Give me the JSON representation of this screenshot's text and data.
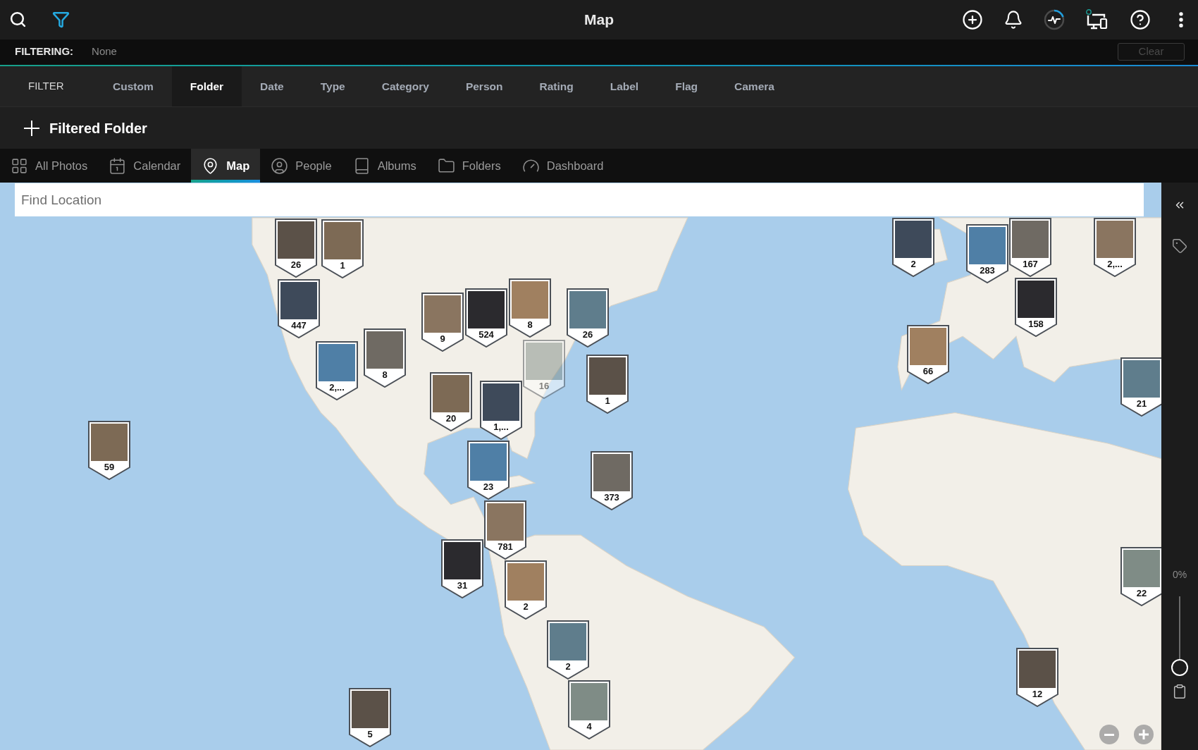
{
  "top_bar": {
    "title": "Map"
  },
  "filter_status": {
    "label": "FILTERING:",
    "value": "None",
    "clear_button": {
      "label": "Clear",
      "disabled": true
    }
  },
  "filter_bar": {
    "heading": "FILTER",
    "tabs": [
      {
        "label": "Custom",
        "selected": false
      },
      {
        "label": "Folder",
        "selected": true
      },
      {
        "label": "Date",
        "selected": false
      },
      {
        "label": "Type",
        "selected": false
      },
      {
        "label": "Category",
        "selected": false
      },
      {
        "label": "Person",
        "selected": false
      },
      {
        "label": "Rating",
        "selected": false
      },
      {
        "label": "Label",
        "selected": false
      },
      {
        "label": "Flag",
        "selected": false
      },
      {
        "label": "Camera",
        "selected": false
      }
    ]
  },
  "filtered_folder": {
    "label": "Filtered Folder"
  },
  "view_tabs": [
    {
      "label": "All Photos",
      "selected": false
    },
    {
      "label": "Calendar",
      "selected": false
    },
    {
      "label": "Map",
      "selected": true
    },
    {
      "label": "People",
      "selected": false
    },
    {
      "label": "Albums",
      "selected": false
    },
    {
      "label": "Folders",
      "selected": false
    },
    {
      "label": "Dashboard",
      "selected": false
    }
  ],
  "map": {
    "search": {
      "placeholder": "Find Location"
    },
    "markers": [
      {
        "count": "26",
        "dimmed": false
      },
      {
        "count": "1",
        "dimmed": false
      },
      {
        "count": "447",
        "dimmed": false
      },
      {
        "count": "2,...",
        "dimmed": false
      },
      {
        "count": "8",
        "dimmed": false
      },
      {
        "count": "9",
        "dimmed": false
      },
      {
        "count": "524",
        "dimmed": false
      },
      {
        "count": "8",
        "dimmed": false
      },
      {
        "count": "26",
        "dimmed": false
      },
      {
        "count": "16",
        "dimmed": true
      },
      {
        "count": "1",
        "dimmed": false
      },
      {
        "count": "20",
        "dimmed": false
      },
      {
        "count": "1,...",
        "dimmed": false
      },
      {
        "count": "23",
        "dimmed": false
      },
      {
        "count": "373",
        "dimmed": false
      },
      {
        "count": "781",
        "dimmed": false
      },
      {
        "count": "31",
        "dimmed": false
      },
      {
        "count": "2",
        "dimmed": false
      },
      {
        "count": "2",
        "dimmed": false
      },
      {
        "count": "4",
        "dimmed": false
      },
      {
        "count": "5",
        "dimmed": false
      },
      {
        "count": "59",
        "dimmed": false
      },
      {
        "count": "2",
        "dimmed": false
      },
      {
        "count": "283",
        "dimmed": false
      },
      {
        "count": "167",
        "dimmed": false
      },
      {
        "count": "2,...",
        "dimmed": false
      },
      {
        "count": "158",
        "dimmed": false
      },
      {
        "count": "66",
        "dimmed": false
      },
      {
        "count": "21",
        "dimmed": false
      },
      {
        "count": "22",
        "dimmed": false
      },
      {
        "count": "12",
        "dimmed": false
      }
    ]
  },
  "side_panel": {
    "zoom_slider": {
      "reading": "0%",
      "level": 0
    }
  }
}
